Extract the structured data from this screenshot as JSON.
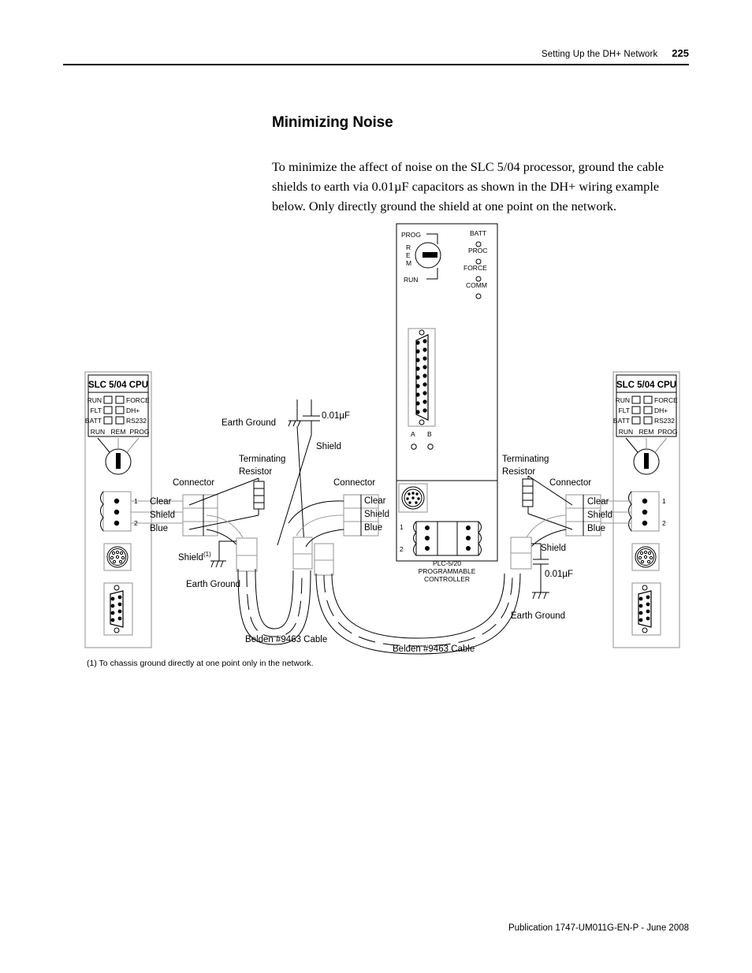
{
  "header": {
    "title": "Setting Up the DH+ Network",
    "page_number": "225"
  },
  "section": {
    "title": "Minimizing Noise",
    "body": "To minimize the affect of noise on the SLC 5/04 processor, ground the cable shields to earth via 0.01µF capacitors as shown in the DH+ wiring example below. Only directly ground the shield at one point on the network."
  },
  "footer": {
    "publication": "Publication 1747-UM011G-EN-P - June 2008"
  },
  "footnote": {
    "text": "(1) To chassis ground directly at one point only in the network."
  },
  "diagram": {
    "plc": {
      "keyswitch": {
        "prog": "PROG",
        "rem_r": "R",
        "rem_e": "E",
        "rem_m": "M",
        "run": "RUN"
      },
      "leds": [
        "BATT",
        "PROC",
        "FORCE",
        "COMM"
      ],
      "port_labels": [
        "A",
        "B"
      ],
      "terminal_labels": [
        "1",
        "2"
      ],
      "name_line1": "PLC-5/20",
      "name_line2": "PROGRAMMABLE",
      "name_line3": "CONTROLLER"
    },
    "slc_left": {
      "title": "SLC 5/04 CPU",
      "leds_left": [
        "RUN",
        "FLT",
        "BATT"
      ],
      "leds_right": [
        "FORCE",
        "DH+",
        "RS232"
      ],
      "mode_labels": [
        "RUN",
        "REM",
        "PROG"
      ],
      "terminal_labels": [
        "1",
        "2"
      ]
    },
    "slc_right": {
      "title": "SLC 5/04 CPU",
      "leds_left": [
        "RUN",
        "FLT",
        "BATT"
      ],
      "leds_right": [
        "FORCE",
        "DH+",
        "RS232"
      ],
      "mode_labels": [
        "RUN",
        "REM",
        "PROG"
      ],
      "terminal_labels": [
        "1",
        "2"
      ]
    },
    "labels": {
      "earth_ground_top": "Earth Ground",
      "capacitor_top": "0.01µF",
      "shield_top": "Shield",
      "terminating_resistor_left_1": "Terminating",
      "terminating_resistor_left_2": "Resistor",
      "connector_left": "Connector",
      "wire_clear_left": "Clear",
      "wire_shield_left": "Shield",
      "wire_blue_left": "Blue",
      "shield_footnote": "Shield",
      "shield_footnote_marker": "(1)",
      "earth_ground_left": "Earth Ground",
      "connector_mid": "Connector",
      "wire_clear_mid": "Clear",
      "wire_shield_mid": "Shield",
      "wire_blue_mid": "Blue",
      "cable_left": "Belden #9463 Cable",
      "cable_right": "Belden #9463 Cable",
      "terminating_resistor_right_1": "Terminating",
      "terminating_resistor_right_2": "Resistor",
      "connector_right": "Connector",
      "wire_clear_right": "Clear",
      "wire_shield_right": "Shield",
      "wire_blue_right": "Blue",
      "shield_right": "Shield",
      "capacitor_right": "0.01µF",
      "earth_ground_right": "Earth Ground"
    }
  }
}
